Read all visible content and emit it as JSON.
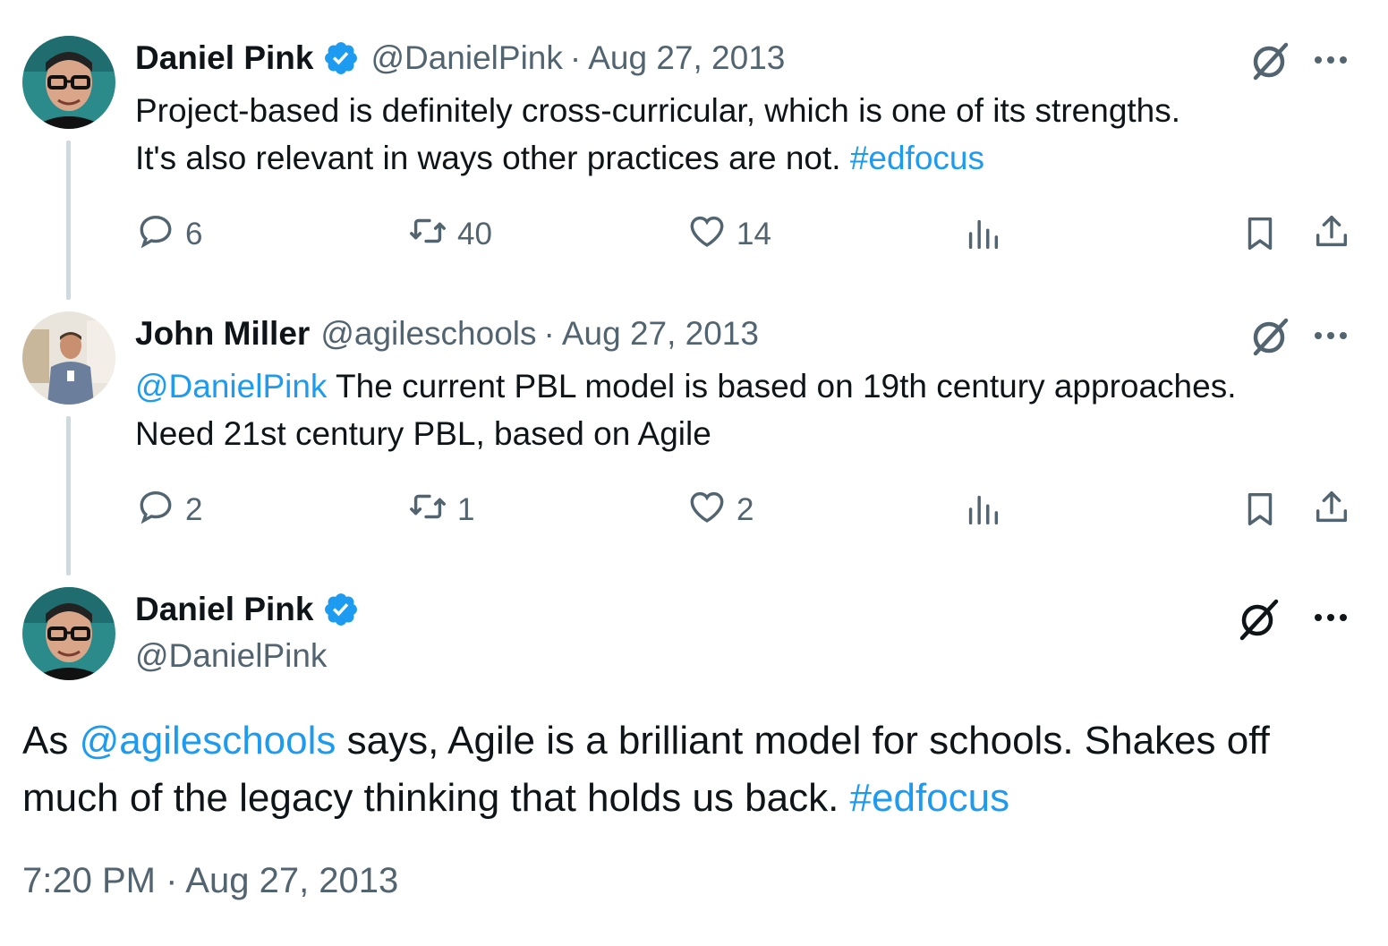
{
  "colors": {
    "link": "#1d9bf0",
    "secondary": "#536471",
    "primary": "#0f1419",
    "verified": "#1d9bf0",
    "thread_line": "#cfd9de"
  },
  "tweets": [
    {
      "name": "Daniel Pink",
      "verified": true,
      "handle": "@DanielPink",
      "separator": "·",
      "date": "Aug 27, 2013",
      "text_lines": [
        {
          "plain": "Project-based is definitely cross-curricular, which is one of its strengths."
        },
        {
          "plain": "It's also relevant in ways other practices are not. ",
          "link": "#edfocus"
        }
      ],
      "actions": {
        "replies": "6",
        "retweets": "40",
        "likes": "14"
      }
    },
    {
      "name": "John Miller",
      "verified": false,
      "handle": "@agileschools",
      "separator": "·",
      "date": "Aug 27, 2013",
      "text_lines": [
        {
          "mention": "@DanielPink",
          "plain": " The current PBL model is based on 19th century approaches."
        },
        {
          "plain": "Need 21st century PBL, based on Agile"
        }
      ],
      "actions": {
        "replies": "2",
        "retweets": "1",
        "likes": "2"
      }
    }
  ],
  "main_tweet": {
    "name": "Daniel Pink",
    "verified": true,
    "handle": "@DanielPink",
    "line1": {
      "pre": "As ",
      "mention": "@agileschools",
      "post": " says, Agile is a brilliant model for schools. Shakes off"
    },
    "line2": {
      "plain": "much of the legacy thinking that holds us back. ",
      "link": "#edfocus"
    },
    "timestamp": "7:20 PM · Aug 27, 2013"
  },
  "icons": [
    "grok-icon",
    "more-icon",
    "reply-icon",
    "retweet-icon",
    "like-icon",
    "views-icon",
    "bookmark-icon",
    "share-icon",
    "verified-badge-icon"
  ]
}
